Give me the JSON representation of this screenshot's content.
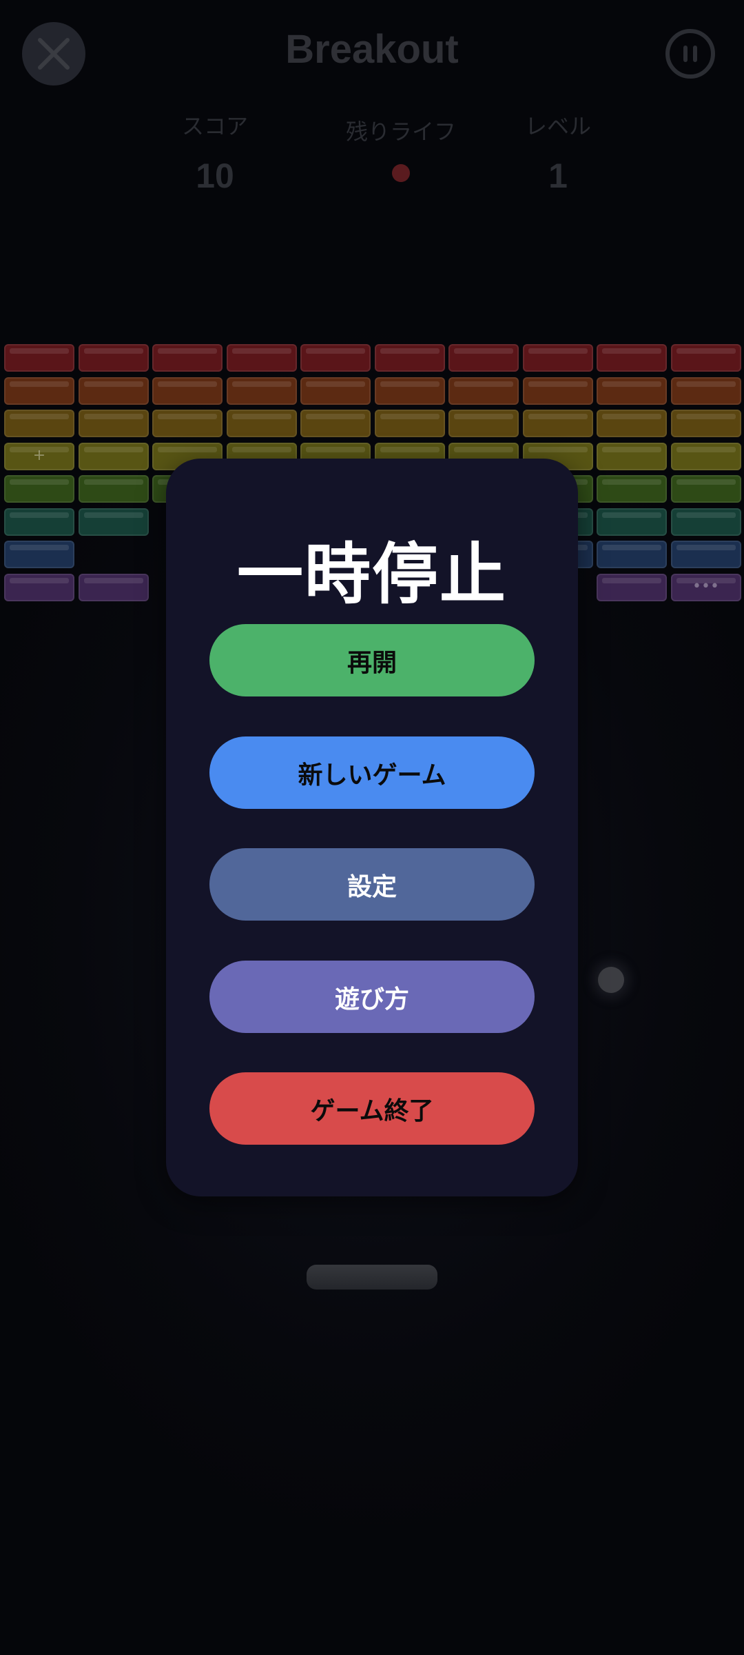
{
  "header": {
    "title": "Breakout",
    "close_icon": "close-x-icon",
    "pause_icon": "pause-icon"
  },
  "stats": {
    "score_label": "スコア",
    "score_value": "10",
    "lives_label": "残りライフ",
    "lives_remaining": 1,
    "level_label": "レベル",
    "level_value": "1"
  },
  "bricks": {
    "row_colors": [
      "#5a1519",
      "#5c2a12",
      "#5a4510",
      "#585514",
      "#2e4a16",
      "#153f36",
      "#1b2f4f",
      "#3b2550"
    ],
    "rows": [
      [
        1,
        1,
        1,
        1,
        1,
        1,
        1,
        1,
        1,
        1
      ],
      [
        1,
        1,
        1,
        1,
        1,
        1,
        1,
        1,
        1,
        1
      ],
      [
        1,
        1,
        1,
        1,
        1,
        1,
        1,
        1,
        1,
        1
      ],
      [
        1,
        1,
        1,
        1,
        1,
        1,
        1,
        1,
        1,
        1
      ],
      [
        1,
        1,
        1,
        1,
        1,
        1,
        1,
        1,
        1,
        1
      ],
      [
        1,
        1,
        0,
        0,
        0,
        0,
        0,
        1,
        1,
        1
      ],
      [
        1,
        0,
        0,
        0,
        0,
        0,
        0,
        1,
        1,
        1
      ],
      [
        1,
        1,
        0,
        0,
        0,
        0,
        0,
        0,
        1,
        1
      ]
    ],
    "marks": [
      {
        "row": 3,
        "col": 0,
        "symbol": "+"
      },
      {
        "row": 7,
        "col": 9,
        "symbol": "•••"
      }
    ]
  },
  "pause_menu": {
    "title": "一時停止",
    "buttons": [
      {
        "label": "再開",
        "color": "#4cb26a",
        "text_color": "#0b0b0b"
      },
      {
        "label": "新しいゲーム",
        "color": "#4a8bf0",
        "text_color": "#0b0b0b"
      },
      {
        "label": "設定",
        "color": "#51679a",
        "text_color": "#ffffff"
      },
      {
        "label": "遊び方",
        "color": "#6a69b6",
        "text_color": "#ffffff"
      },
      {
        "label": "ゲーム終了",
        "color": "#d84b4b",
        "text_color": "#0b0b0b"
      }
    ]
  }
}
